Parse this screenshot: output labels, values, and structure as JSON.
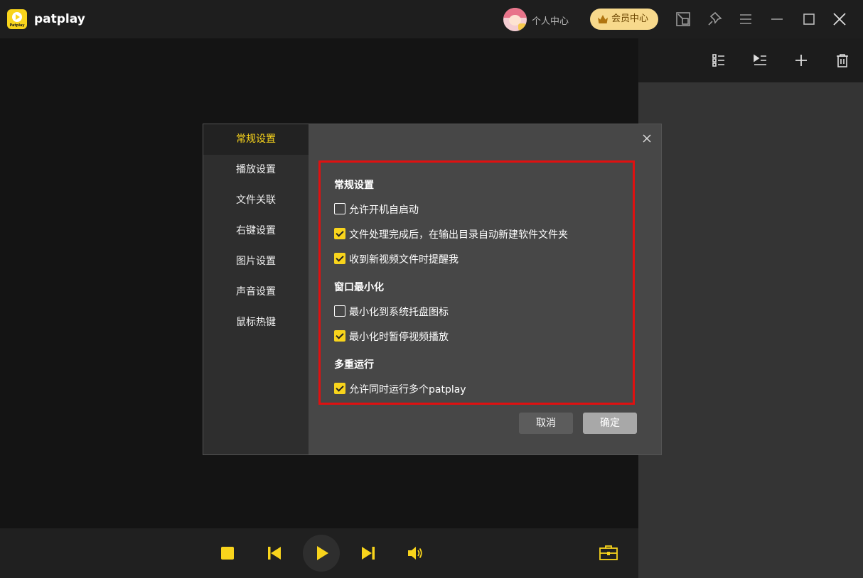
{
  "app": {
    "title": "patplay",
    "logo_text": "Patplay"
  },
  "titlebar": {
    "user_center": "个人中心",
    "vip_center": "会员中心"
  },
  "dialog": {
    "sidebar": [
      "常规设置",
      "播放设置",
      "文件关联",
      "右键设置",
      "图片设置",
      "声音设置",
      "鼠标热键"
    ],
    "sections": {
      "general": "常规设置",
      "minimize": "窗口最小化",
      "multi": "多重运行"
    },
    "options": [
      {
        "label": "允许开机自启动",
        "checked": false
      },
      {
        "label": "文件处理完成后，在输出目录自动新建软件文件夹",
        "checked": true
      },
      {
        "label": "收到新视频文件时提醒我",
        "checked": true
      },
      {
        "label": "最小化到系统托盘图标",
        "checked": false
      },
      {
        "label": "最小化时暂停视频播放",
        "checked": true
      },
      {
        "label": "允许同时运行多个patplay",
        "checked": true
      }
    ],
    "buttons": {
      "cancel": "取消",
      "ok": "确定"
    }
  },
  "colors": {
    "accent": "#f8d41c",
    "highlight_border": "#e01010"
  },
  "icons": [
    "screen-capture-icon",
    "pin-icon",
    "menu-icon",
    "minimize-icon",
    "maximize-icon",
    "close-icon",
    "list-view-icon",
    "play-list-icon",
    "add-icon",
    "delete-icon",
    "stop-icon",
    "previous-icon",
    "play-icon",
    "next-icon",
    "volume-icon",
    "toolbox-icon"
  ]
}
